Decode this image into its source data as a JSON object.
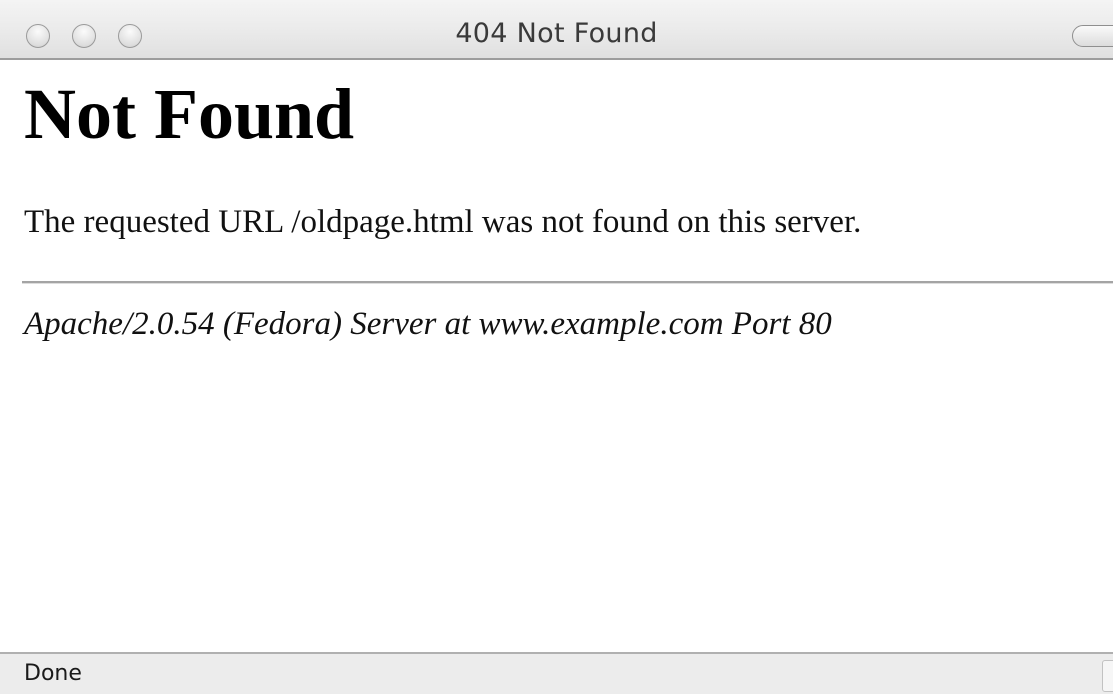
{
  "window": {
    "title": "404 Not Found"
  },
  "page": {
    "heading": "Not Found",
    "message": "The requested URL /oldpage.html was not found on this server.",
    "signature": "Apache/2.0.54 (Fedora) Server at www.example.com Port 80"
  },
  "status_bar": {
    "text": "Done"
  },
  "colors": {
    "title_bar": "#e8e8e8",
    "divider": "#a4a4a4",
    "status_bar": "#ececec"
  }
}
